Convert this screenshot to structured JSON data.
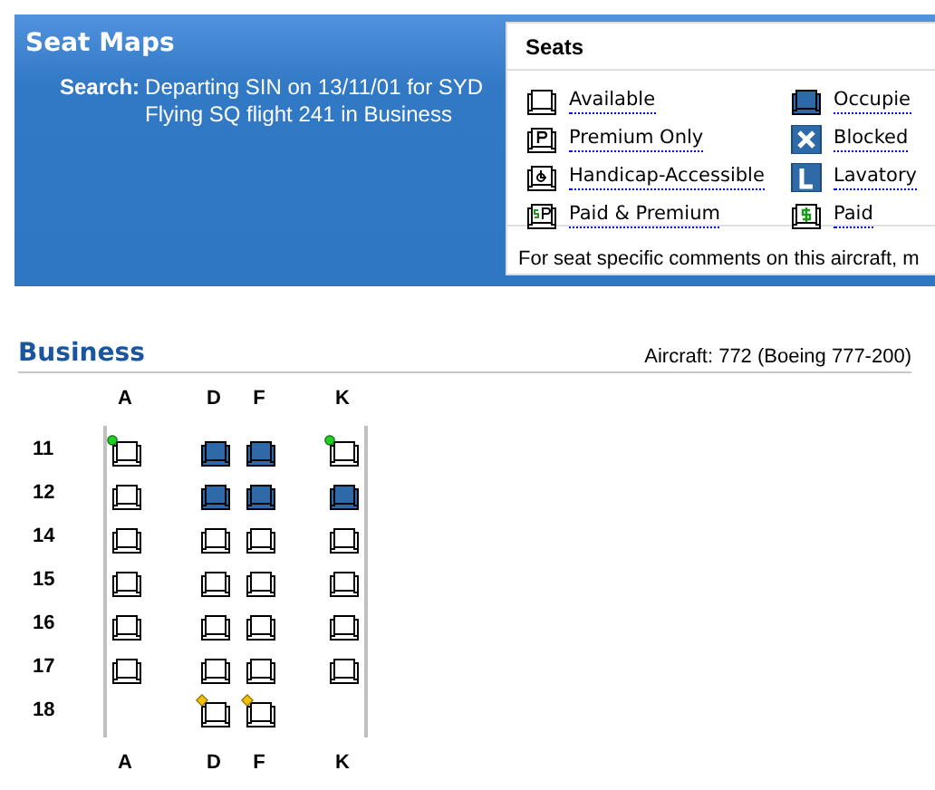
{
  "header": {
    "title": "Seat Maps",
    "search_label": "Search:",
    "search_lines": [
      "Departing SIN on 13/11/01 for SYD",
      "Flying SQ flight 241 in Business"
    ]
  },
  "legend": {
    "title": "Seats",
    "items": [
      {
        "kind": "available",
        "label": "Available"
      },
      {
        "kind": "occupied",
        "label": "Occupie"
      },
      {
        "kind": "premium",
        "label": "Premium Only"
      },
      {
        "kind": "blocked",
        "label": "Blocked"
      },
      {
        "kind": "handicap",
        "label": "Handicap-Accessible"
      },
      {
        "kind": "lavatory",
        "label": "Lavatory"
      },
      {
        "kind": "paid_premium",
        "label": "Paid & Premium"
      },
      {
        "kind": "paid",
        "label": "Paid"
      }
    ],
    "note": "For seat specific comments on this aircraft, m"
  },
  "cabin": {
    "title": "Business",
    "aircraft": "Aircraft: 772 (Boeing 777-200)",
    "columns_top": [
      "A",
      "D",
      "F",
      "K"
    ],
    "columns_bottom": [
      "A",
      "D",
      "F",
      "K"
    ],
    "rows": [
      {
        "number": "11",
        "seats": [
          {
            "kind": "available",
            "green_dot": true,
            "yellow_diamond": false
          },
          {
            "kind": "occupied",
            "green_dot": false,
            "yellow_diamond": false
          },
          {
            "kind": "occupied",
            "green_dot": false,
            "yellow_diamond": false
          },
          {
            "kind": "available",
            "green_dot": true,
            "yellow_diamond": false
          }
        ]
      },
      {
        "number": "12",
        "seats": [
          {
            "kind": "available",
            "green_dot": false,
            "yellow_diamond": false
          },
          {
            "kind": "occupied",
            "green_dot": false,
            "yellow_diamond": false
          },
          {
            "kind": "occupied",
            "green_dot": false,
            "yellow_diamond": false
          },
          {
            "kind": "occupied",
            "green_dot": false,
            "yellow_diamond": false
          }
        ]
      },
      {
        "number": "14",
        "seats": [
          {
            "kind": "available",
            "green_dot": false,
            "yellow_diamond": false
          },
          {
            "kind": "available",
            "green_dot": false,
            "yellow_diamond": false
          },
          {
            "kind": "available",
            "green_dot": false,
            "yellow_diamond": false
          },
          {
            "kind": "available",
            "green_dot": false,
            "yellow_diamond": false
          }
        ]
      },
      {
        "number": "15",
        "seats": [
          {
            "kind": "available",
            "green_dot": false,
            "yellow_diamond": false
          },
          {
            "kind": "available",
            "green_dot": false,
            "yellow_diamond": false
          },
          {
            "kind": "available",
            "green_dot": false,
            "yellow_diamond": false
          },
          {
            "kind": "available",
            "green_dot": false,
            "yellow_diamond": false
          }
        ]
      },
      {
        "number": "16",
        "seats": [
          {
            "kind": "available",
            "green_dot": false,
            "yellow_diamond": false
          },
          {
            "kind": "available",
            "green_dot": false,
            "yellow_diamond": false
          },
          {
            "kind": "available",
            "green_dot": false,
            "yellow_diamond": false
          },
          {
            "kind": "available",
            "green_dot": false,
            "yellow_diamond": false
          }
        ]
      },
      {
        "number": "17",
        "seats": [
          {
            "kind": "available",
            "green_dot": false,
            "yellow_diamond": false
          },
          {
            "kind": "available",
            "green_dot": false,
            "yellow_diamond": false
          },
          {
            "kind": "available",
            "green_dot": false,
            "yellow_diamond": false
          },
          {
            "kind": "available",
            "green_dot": false,
            "yellow_diamond": false
          }
        ]
      },
      {
        "number": "18",
        "seats": [
          {
            "kind": "none",
            "green_dot": false,
            "yellow_diamond": false
          },
          {
            "kind": "available",
            "green_dot": false,
            "yellow_diamond": true
          },
          {
            "kind": "available",
            "green_dot": false,
            "yellow_diamond": true
          },
          {
            "kind": "none",
            "green_dot": false,
            "yellow_diamond": false
          }
        ]
      }
    ]
  }
}
